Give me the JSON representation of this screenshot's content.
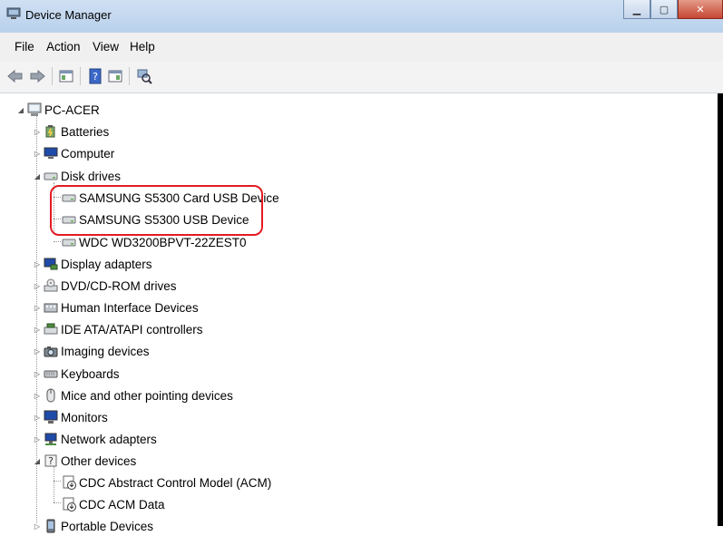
{
  "window": {
    "title": "Device Manager"
  },
  "menu": [
    "File",
    "Action",
    "View",
    "Help"
  ],
  "tree": {
    "root": "PC-ACER",
    "items": [
      {
        "label": "Batteries",
        "icon": "battery-icon"
      },
      {
        "label": "Computer",
        "icon": "computer-icon"
      },
      {
        "label": "Disk drives",
        "icon": "disk-drive-icon",
        "expanded": true,
        "children": [
          "SAMSUNG S5300 Card USB Device",
          "SAMSUNG S5300 USB Device",
          "WDC WD3200BPVT-22ZEST0"
        ]
      },
      {
        "label": "Display adapters",
        "icon": "display-adapter-icon"
      },
      {
        "label": "DVD/CD-ROM drives",
        "icon": "dvd-drive-icon"
      },
      {
        "label": "Human Interface Devices",
        "icon": "hid-icon"
      },
      {
        "label": "IDE ATA/ATAPI controllers",
        "icon": "ide-controller-icon"
      },
      {
        "label": "Imaging devices",
        "icon": "camera-icon"
      },
      {
        "label": "Keyboards",
        "icon": "keyboard-icon"
      },
      {
        "label": "Mice and other pointing devices",
        "icon": "mouse-icon"
      },
      {
        "label": "Monitors",
        "icon": "monitor-icon"
      },
      {
        "label": "Network adapters",
        "icon": "network-adapter-icon"
      },
      {
        "label": "Other devices",
        "icon": "other-devices-icon",
        "expanded": true,
        "children": [
          "CDC Abstract Control Model (ACM)",
          "CDC ACM Data"
        ]
      },
      {
        "label": "Portable Devices",
        "icon": "portable-device-icon"
      }
    ]
  },
  "colors": {
    "highlight": "#e31b23",
    "titlebar": "#c4d8ef"
  }
}
